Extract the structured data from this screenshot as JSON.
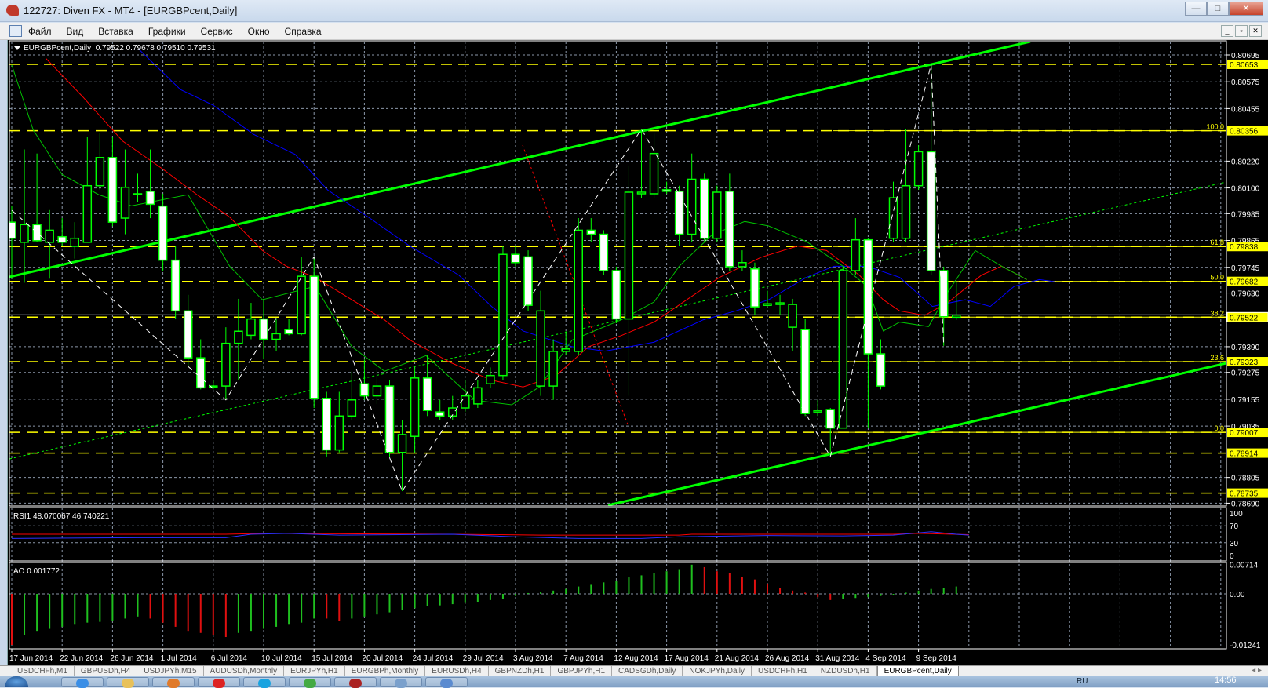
{
  "window": {
    "title": "122727: Diven FX - MT4 - [EURGBPcent,Daily]",
    "minimize": "—",
    "maximize": "□",
    "close": "✕"
  },
  "menu": [
    "Файл",
    "Вид",
    "Вставка",
    "Графики",
    "Сервис",
    "Окно",
    "Справка"
  ],
  "child_controls": [
    "_",
    "▫",
    "✕"
  ],
  "chart_header": "EURGBPcent,Daily  0.79522 0.79678 0.79510 0.79531",
  "rsi_header": "RSI1 48.070067 46.740221",
  "ao_header": "AO 0.001772",
  "colors": {
    "bull": "#00ff00",
    "bear": "#ffffff",
    "level": "#ffff00",
    "grid": "#8a96a8",
    "ma_fast": "#00c000",
    "ma_mid": "#ff0000",
    "ma_slow": "#0000ff",
    "channel": "#00ff00",
    "zigzag": "#ffffff"
  },
  "chart_data": {
    "type": "candlestick",
    "symbol": "EURGBPcent",
    "timeframe": "Daily",
    "ohlc_current": {
      "open": 0.79522,
      "high": 0.79678,
      "low": 0.7951,
      "close": 0.79531
    },
    "date_labels": [
      "17 Jun 2014",
      "22 Jun 2014",
      "26 Jun 2014",
      "1 Jul 2014",
      "6 Jul 2014",
      "10 Jul 2014",
      "15 Jul 2014",
      "20 Jul 2014",
      "24 Jul 2014",
      "29 Jul 2014",
      "3 Aug 2014",
      "7 Aug 2014",
      "12 Aug 2014",
      "17 Aug 2014",
      "21 Aug 2014",
      "26 Aug 2014",
      "31 Aug 2014",
      "4 Sep 2014",
      "9 Sep 2014"
    ],
    "bars_per_date_label": 4,
    "price_ticks": [
      "0.80695",
      "0.80575",
      "0.80455",
      "0.80220",
      "0.80100",
      "0.79985",
      "0.79865",
      "0.79745",
      "0.79630",
      "0.79390",
      "0.79275",
      "0.79155",
      "0.79035",
      "0.78805",
      "0.78690"
    ],
    "ylim": [
      0.7869,
      0.8074
    ],
    "candles": [
      [
        0.79947,
        0.80019,
        0.79694,
        0.79875
      ],
      [
        0.79857,
        0.80272,
        0.79676,
        0.79936
      ],
      [
        0.79936,
        0.80254,
        0.79857,
        0.79864
      ],
      [
        0.79857,
        0.80001,
        0.79694,
        0.79911
      ],
      [
        0.79882,
        0.79965,
        0.79839,
        0.79857
      ],
      [
        0.79839,
        0.79947,
        0.79784,
        0.79875
      ],
      [
        0.79857,
        0.80327,
        0.79857,
        0.8011
      ],
      [
        0.8011,
        0.80345,
        0.80092,
        0.80236
      ],
      [
        0.80236,
        0.80327,
        0.79929,
        0.79947
      ],
      [
        0.79965,
        0.80272,
        0.79893,
        0.80103
      ],
      [
        0.80074,
        0.80164,
        0.80038,
        0.8007
      ],
      [
        0.80085,
        0.80272,
        0.79965,
        0.80027
      ],
      [
        0.80019,
        0.80074,
        0.7973,
        0.79777
      ],
      [
        0.79777,
        0.79839,
        0.79514,
        0.7955
      ],
      [
        0.7955,
        0.79622,
        0.79297,
        0.7934
      ],
      [
        0.7934,
        0.79423,
        0.79199,
        0.79206
      ],
      [
        0.79214,
        0.79242,
        0.79199,
        0.7921
      ],
      [
        0.79214,
        0.79477,
        0.79152,
        0.79405
      ],
      [
        0.79405,
        0.79604,
        0.79242,
        0.79459
      ],
      [
        0.79441,
        0.79586,
        0.79423,
        0.79514
      ],
      [
        0.79514,
        0.79604,
        0.79333,
        0.79423
      ],
      [
        0.79423,
        0.79514,
        0.79369,
        0.79448
      ],
      [
        0.79466,
        0.79514,
        0.79441,
        0.79448
      ],
      [
        0.79448,
        0.79792,
        0.79441,
        0.79705
      ],
      [
        0.79705,
        0.79784,
        0.79116,
        0.79159
      ],
      [
        0.79159,
        0.79188,
        0.78899,
        0.78928
      ],
      [
        0.78928,
        0.79188,
        0.78917,
        0.7908
      ],
      [
        0.7908,
        0.79279,
        0.79062,
        0.79152
      ],
      [
        0.79224,
        0.79333,
        0.79152,
        0.7917
      ],
      [
        0.7917,
        0.79297,
        0.79134,
        0.79214
      ],
      [
        0.79214,
        0.79242,
        0.78899,
        0.78917
      ],
      [
        0.78917,
        0.79062,
        0.78744,
        0.78997
      ],
      [
        0.78989,
        0.79297,
        0.78917,
        0.7925
      ],
      [
        0.7925,
        0.79351,
        0.7908,
        0.79105
      ],
      [
        0.79098,
        0.79152,
        0.79062,
        0.7908
      ],
      [
        0.7908,
        0.7917,
        0.79062,
        0.79116
      ],
      [
        0.79116,
        0.79242,
        0.79098,
        0.7917
      ],
      [
        0.79134,
        0.79242,
        0.79116,
        0.79206
      ],
      [
        0.79224,
        0.79297,
        0.79206,
        0.79261
      ],
      [
        0.79261,
        0.79839,
        0.79242,
        0.79803
      ],
      [
        0.79803,
        0.79839,
        0.79748,
        0.79766
      ],
      [
        0.79792,
        0.79821,
        0.7955,
        0.79575
      ],
      [
        0.79214,
        0.7964,
        0.7917,
        0.7955
      ],
      [
        0.79214,
        0.79423,
        0.79152,
        0.79369
      ],
      [
        0.79369,
        0.79459,
        0.79351,
        0.7938
      ],
      [
        0.79369,
        0.79965,
        0.79351,
        0.79911
      ],
      [
        0.79911,
        0.79965,
        0.79857,
        0.79893
      ],
      [
        0.79893,
        0.79911,
        0.79712,
        0.7973
      ],
      [
        0.7973,
        0.79748,
        0.79495,
        0.79514
      ],
      [
        0.79514,
        0.802,
        0.7917,
        0.80081
      ],
      [
        0.80074,
        0.80363,
        0.80056,
        0.80081
      ],
      [
        0.80074,
        0.80345,
        0.80056,
        0.80254
      ],
      [
        0.80092,
        0.80128,
        0.80074,
        0.80085
      ],
      [
        0.80085,
        0.8011,
        0.79839,
        0.79893
      ],
      [
        0.79893,
        0.80254,
        0.79857,
        0.80139
      ],
      [
        0.80139,
        0.80164,
        0.79857,
        0.79875
      ],
      [
        0.79875,
        0.8011,
        0.79857,
        0.80081
      ],
      [
        0.80085,
        0.80164,
        0.7973,
        0.79748
      ],
      [
        0.79748,
        0.79821,
        0.7973,
        0.79766
      ],
      [
        0.79738,
        0.79766,
        0.79532,
        0.79568
      ],
      [
        0.79575,
        0.7964,
        0.79568,
        0.79582
      ],
      [
        0.79579,
        0.79622,
        0.79532,
        0.79586
      ],
      [
        0.79477,
        0.79604,
        0.79369,
        0.79579
      ],
      [
        0.79466,
        0.79514,
        0.7908,
        0.79091
      ],
      [
        0.79098,
        0.79152,
        0.7908,
        0.79105
      ],
      [
        0.79109,
        0.79116,
        0.78917,
        0.79026
      ],
      [
        0.79026,
        0.79748,
        0.79026,
        0.7973
      ],
      [
        0.7973,
        0.79965,
        0.79712,
        0.79868
      ],
      [
        0.79868,
        0.79875,
        0.79026,
        0.79358
      ],
      [
        0.79358,
        0.79423,
        0.79199,
        0.79214
      ],
      [
        0.79875,
        0.80128,
        0.79857,
        0.80056
      ],
      [
        0.79875,
        0.80363,
        0.79857,
        0.8011
      ],
      [
        0.8011,
        0.80291,
        0.80092,
        0.80262
      ],
      [
        0.80262,
        0.80652,
        0.79712,
        0.7973
      ],
      [
        0.7973,
        0.79748,
        0.79394,
        0.79524
      ],
      [
        0.79522,
        0.79678,
        0.7951,
        0.79531
      ]
    ],
    "levels": [
      {
        "price": 0.80653,
        "tag": "0.80653",
        "fibo": ""
      },
      {
        "price": 0.80356,
        "tag": "0.80356",
        "fibo": "100.0"
      },
      {
        "price": 0.79838,
        "tag": "0.79838",
        "fibo": "61.8"
      },
      {
        "price": 0.79682,
        "tag": "0.79682",
        "fibo": "50.0"
      },
      {
        "price": 0.79522,
        "tag": "0.79522",
        "fibo": "38.2"
      },
      {
        "price": 0.79323,
        "tag": "0.79323",
        "fibo": "23.6"
      },
      {
        "price": 0.79007,
        "tag": "0.79007",
        "fibo": "0.0"
      },
      {
        "price": 0.78914,
        "tag": "0.78914",
        "fibo": ""
      },
      {
        "price": 0.78735,
        "tag": "0.78735",
        "fibo": ""
      }
    ],
    "bid_price": 0.79522,
    "zigzag": [
      [
        0,
        0.8
      ],
      [
        17,
        0.79152
      ],
      [
        24,
        0.79792
      ],
      [
        31,
        0.78744
      ],
      [
        50,
        0.80363
      ],
      [
        65,
        0.78899
      ],
      [
        73,
        0.80652
      ],
      [
        74,
        0.79394
      ]
    ],
    "ma_fast": [
      [
        0,
        0.8065
      ],
      [
        1.7,
        0.8036
      ],
      [
        4,
        0.8016
      ],
      [
        6.9,
        0.8007
      ],
      [
        9.5,
        0.8002
      ],
      [
        14,
        0.8007
      ],
      [
        17.3,
        0.7975
      ],
      [
        19.9,
        0.796
      ],
      [
        24.1,
        0.7966
      ],
      [
        27,
        0.7939
      ],
      [
        29.6,
        0.7928
      ],
      [
        32.9,
        0.7935
      ],
      [
        36.8,
        0.7915
      ],
      [
        39.7,
        0.7913
      ],
      [
        41.9,
        0.7921
      ],
      [
        44.5,
        0.7942
      ],
      [
        48.4,
        0.7951
      ],
      [
        51,
        0.7959
      ],
      [
        53,
        0.7975
      ],
      [
        55.6,
        0.7989
      ],
      [
        58.2,
        0.7995
      ],
      [
        60.1,
        0.7993
      ],
      [
        63.1,
        0.7986
      ],
      [
        66,
        0.7975
      ],
      [
        67.9,
        0.7966
      ],
      [
        69.2,
        0.7946
      ],
      [
        70.5,
        0.795
      ],
      [
        72.8,
        0.7948
      ],
      [
        74.4,
        0.7964
      ],
      [
        76.5,
        0.7982
      ],
      [
        78.6,
        0.7975
      ],
      [
        80.6,
        0.7969
      ]
    ],
    "ma_mid": [
      [
        2.7,
        0.8068
      ],
      [
        5.6,
        0.8051
      ],
      [
        8.8,
        0.8031
      ],
      [
        12.1,
        0.8018
      ],
      [
        14.7,
        0.8007
      ],
      [
        17.3,
        0.7997
      ],
      [
        19.9,
        0.7982
      ],
      [
        21.8,
        0.7975
      ],
      [
        24.1,
        0.797
      ],
      [
        27,
        0.796
      ],
      [
        29.6,
        0.7951
      ],
      [
        31.6,
        0.7942
      ],
      [
        34.8,
        0.7932
      ],
      [
        38.1,
        0.7924
      ],
      [
        40.6,
        0.7921
      ],
      [
        43.2,
        0.7926
      ],
      [
        45.8,
        0.7939
      ],
      [
        48.4,
        0.7944
      ],
      [
        51,
        0.795
      ],
      [
        53.6,
        0.796
      ],
      [
        56.2,
        0.797
      ],
      [
        59.5,
        0.7979
      ],
      [
        62.4,
        0.7984
      ],
      [
        64.7,
        0.7982
      ],
      [
        67.3,
        0.7971
      ],
      [
        69.2,
        0.796
      ],
      [
        70.5,
        0.7955
      ],
      [
        72.5,
        0.7953
      ],
      [
        74.4,
        0.7959
      ],
      [
        77,
        0.7971
      ],
      [
        78.6,
        0.7975
      ],
      [
        80.6,
        0.7969
      ]
    ],
    "ma_slow": [
      [
        10.1,
        0.8072
      ],
      [
        13.4,
        0.8054
      ],
      [
        16,
        0.8047
      ],
      [
        19.2,
        0.8034
      ],
      [
        22.5,
        0.8025
      ],
      [
        25.1,
        0.8009
      ],
      [
        28.3,
        0.7997
      ],
      [
        31.6,
        0.7984
      ],
      [
        35.5,
        0.7971
      ],
      [
        38.1,
        0.7957
      ],
      [
        40.6,
        0.7946
      ],
      [
        44.5,
        0.7939
      ],
      [
        47.1,
        0.7937
      ],
      [
        51,
        0.7941
      ],
      [
        54.9,
        0.7951
      ],
      [
        57.5,
        0.7955
      ],
      [
        60.1,
        0.796
      ],
      [
        63.1,
        0.797
      ],
      [
        65.3,
        0.7975
      ],
      [
        67.9,
        0.7975
      ],
      [
        70.5,
        0.797
      ],
      [
        73.1,
        0.7957
      ],
      [
        75.7,
        0.796
      ],
      [
        77.7,
        0.7957
      ],
      [
        79.6,
        0.7966
      ],
      [
        81.6,
        0.7969
      ],
      [
        82.9,
        0.7968
      ]
    ],
    "rsi": {
      "ticks": [
        "100",
        "70",
        "30",
        "0"
      ],
      "levels": [
        100,
        70,
        30,
        0
      ],
      "line1": [
        [
          0,
          40
        ],
        [
          10,
          42
        ],
        [
          17,
          42
        ],
        [
          19,
          50
        ],
        [
          22,
          52
        ],
        [
          26,
          48
        ],
        [
          35,
          50
        ],
        [
          40,
          44
        ],
        [
          45,
          40
        ],
        [
          50,
          40
        ],
        [
          53,
          44
        ],
        [
          60,
          47
        ],
        [
          66,
          46
        ],
        [
          70,
          48
        ],
        [
          73,
          56
        ],
        [
          75,
          50
        ],
        [
          76,
          48
        ]
      ],
      "line2": [
        [
          0,
          50
        ],
        [
          17,
          50
        ],
        [
          20,
          52
        ],
        [
          35,
          50
        ],
        [
          42,
          48
        ],
        [
          53,
          48
        ],
        [
          54,
          50
        ],
        [
          70,
          50
        ],
        [
          72,
          52
        ],
        [
          76,
          49
        ]
      ]
    },
    "ao": {
      "ticks": [
        "0.00714",
        "0.00",
        "-0.01241"
      ],
      "tick_values": [
        0.00714,
        0,
        -0.01241
      ],
      "values": [
        -0.0124,
        -0.01,
        -0.009,
        -0.0085,
        -0.008,
        -0.0075,
        -0.007,
        -0.0068,
        -0.0065,
        -0.006,
        -0.0055,
        -0.006,
        -0.007,
        -0.008,
        -0.009,
        -0.0095,
        -0.01,
        -0.0105,
        -0.0095,
        -0.009,
        -0.0085,
        -0.008,
        -0.0075,
        -0.007,
        -0.006,
        -0.006,
        -0.0065,
        -0.006,
        -0.0055,
        -0.005,
        -0.0045,
        -0.004,
        -0.0035,
        -0.003,
        -0.0028,
        -0.0025,
        -0.0022,
        -0.002,
        -0.0015,
        -0.0012,
        -0.0005,
        0.0002,
        0.0005,
        0.0008,
        0.0012,
        0.0018,
        0.0022,
        0.0028,
        0.0032,
        0.004,
        0.0045,
        0.005,
        0.0055,
        0.006,
        0.0071,
        0.0065,
        0.0055,
        0.005,
        0.0042,
        0.0035,
        0.0025,
        0.0015,
        0.0008,
        0.0003,
        -0.0008,
        -0.0015,
        -0.0012,
        -0.001,
        -0.0008,
        -0.0005,
        -0.0002,
        0.0003,
        0.0008,
        0.0012,
        0.0015,
        0.0018
      ]
    }
  },
  "tabs": [
    "USDCHFh,M1",
    "GBPUSDh,H4",
    "USDJPYh,M15",
    "AUDUSDh,Monthly",
    "EURJPYh,H1",
    "EURGBPh,Monthly",
    "EURUSDh,H4",
    "GBPNZDh,H1",
    "GBPJPYh,H1",
    "CADSGDh,Daily",
    "NOKJPYh,Daily",
    "USDCHFh,H1",
    "NZDUSDh,H1",
    "EURGBPcent,Daily"
  ],
  "active_tab": "EURGBPcent,Daily",
  "taskbar": {
    "lang": "RU",
    "clock": "14:56"
  }
}
